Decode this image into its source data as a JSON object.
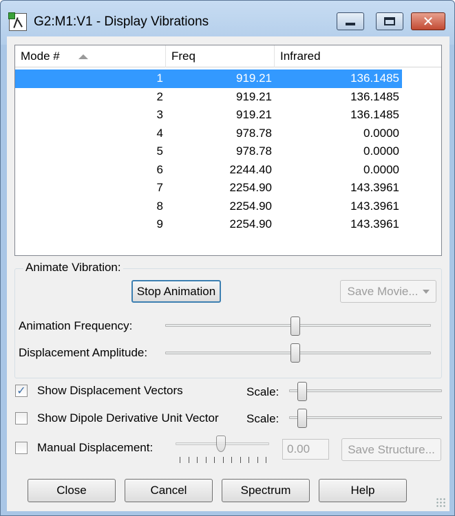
{
  "window": {
    "title": "G2:M1:V1 - Display Vibrations",
    "close_glyph": "✕"
  },
  "list": {
    "columns": [
      "Mode #",
      "Freq",
      "Infrared"
    ],
    "sort_column": "Mode #",
    "rows": [
      {
        "mode": "1",
        "freq": "919.21",
        "ir": "136.1485"
      },
      {
        "mode": "2",
        "freq": "919.21",
        "ir": "136.1485"
      },
      {
        "mode": "3",
        "freq": "919.21",
        "ir": "136.1485"
      },
      {
        "mode": "4",
        "freq": "978.78",
        "ir": "0.0000"
      },
      {
        "mode": "5",
        "freq": "978.78",
        "ir": "0.0000"
      },
      {
        "mode": "6",
        "freq": "2244.40",
        "ir": "0.0000"
      },
      {
        "mode": "7",
        "freq": "2254.90",
        "ir": "143.3961"
      },
      {
        "mode": "8",
        "freq": "2254.90",
        "ir": "143.3961"
      },
      {
        "mode": "9",
        "freq": "2254.90",
        "ir": "143.3961"
      }
    ],
    "selected_row": 0
  },
  "animate": {
    "group_label": "Animate Vibration:",
    "stop_button": "Stop Animation",
    "save_movie": "Save Movie...",
    "frequency_label": "Animation Frequency:",
    "frequency_value": 0.49,
    "amplitude_label": "Displacement Amplitude:",
    "amplitude_value": 0.49
  },
  "options": {
    "show_vectors_label": "Show Displacement Vectors",
    "show_vectors_checked": true,
    "show_vectors_check": "✓",
    "show_dipole_label": "Show Dipole Derivative Unit Vector",
    "show_dipole_checked": false,
    "scale_label": "Scale:",
    "vectors_scale_value": 0.04,
    "dipole_scale_value": 0.04,
    "manual_label": "Manual Displacement:",
    "manual_checked": false,
    "manual_value": "0.00",
    "manual_slider_value": 0.5,
    "save_structure": "Save Structure..."
  },
  "buttons": {
    "close": "Close",
    "cancel": "Cancel",
    "spectrum": "Spectrum",
    "help": "Help"
  }
}
